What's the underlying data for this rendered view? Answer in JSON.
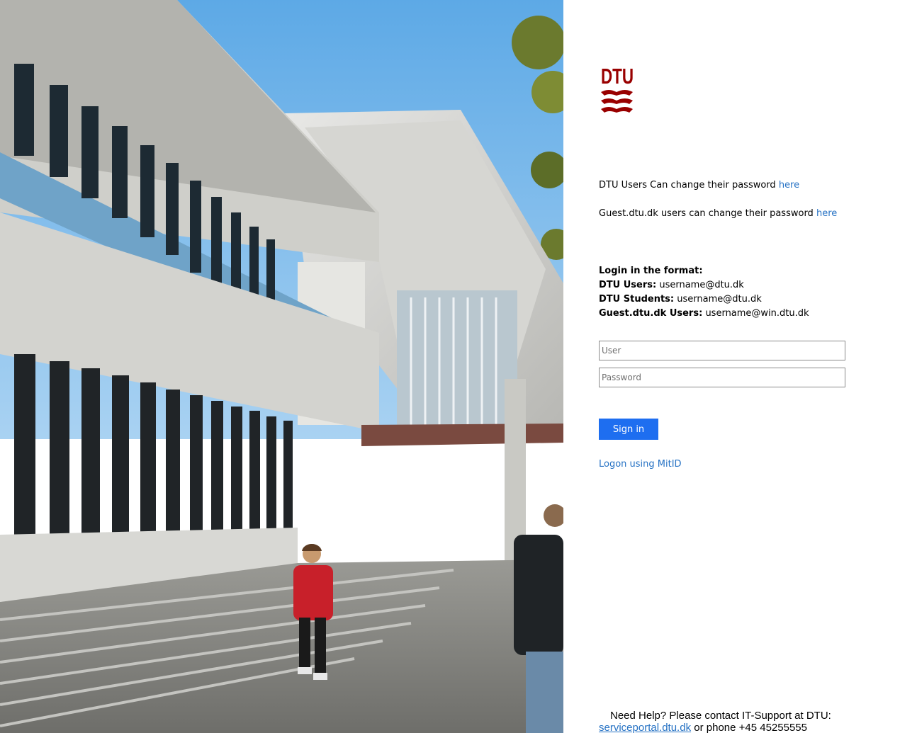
{
  "logo": {
    "text": "DTU",
    "color": "#990000"
  },
  "password_links": {
    "dtu_text": "DTU Users Can change their password",
    "dtu_link": "here",
    "guest_text": "Guest.dtu.dk users can change their password",
    "guest_link": "here",
    "link_color": "#2672c4"
  },
  "login_format": {
    "heading": "Login in the format:",
    "rows": [
      {
        "label": "DTU Users:",
        "value": "username@dtu.dk"
      },
      {
        "label": "DTU Students:",
        "value": "username@dtu.dk"
      },
      {
        "label": "Guest.dtu.dk Users:",
        "value": "username@win.dtu.dk"
      }
    ]
  },
  "form": {
    "user_placeholder": "User",
    "user_value": "",
    "password_placeholder": "Password",
    "password_value": "",
    "signin_label": "Sign in",
    "signin_color": "#1e6ef0",
    "mitid_link": "Logon using MitID"
  },
  "help": {
    "text": "Need Help? Please contact IT-Support at DTU:",
    "portal_link": "serviceportal.dtu.dk",
    "phone_text": "or phone +45 45255555"
  },
  "hero_image": {
    "subject": "campus-building-photo"
  }
}
